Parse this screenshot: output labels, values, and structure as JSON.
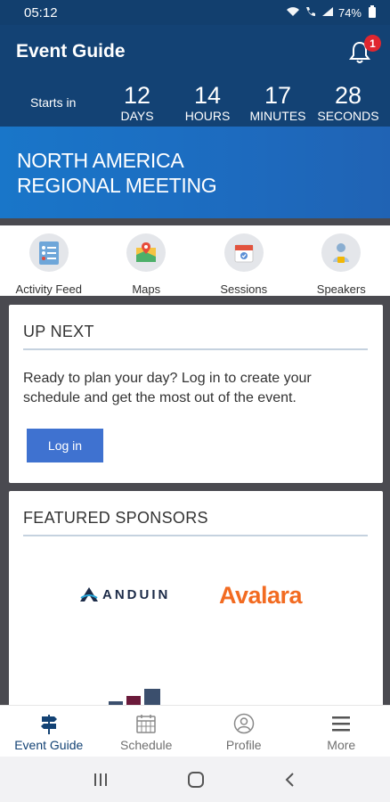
{
  "status_bar": {
    "time": "05:12",
    "battery": "74%"
  },
  "header": {
    "title": "Event Guide",
    "notification_count": "1"
  },
  "countdown": {
    "label": "Starts in",
    "units": [
      {
        "value": "12",
        "label": "DAYS"
      },
      {
        "value": "14",
        "label": "HOURS"
      },
      {
        "value": "17",
        "label": "MINUTES"
      },
      {
        "value": "28",
        "label": "SECONDS"
      }
    ]
  },
  "banner": {
    "line1": "NORTH AMERICA",
    "line2": "REGIONAL MEETING"
  },
  "shortcuts": [
    {
      "label": "Activity Feed",
      "icon": "list-icon"
    },
    {
      "label": "Maps",
      "icon": "map-icon"
    },
    {
      "label": "Sessions",
      "icon": "calendar-icon"
    },
    {
      "label": "Speakers",
      "icon": "speaker-icon"
    }
  ],
  "up_next": {
    "title": "UP NEXT",
    "body": "Ready to plan your day? Log in to create your schedule and get the most out of the event.",
    "button": "Log in"
  },
  "sponsors": {
    "title": "FEATURED SPONSORS",
    "items": [
      "ANDUIN",
      "Avalara"
    ]
  },
  "bottom_nav": [
    {
      "label": "Event Guide",
      "icon": "signpost-icon",
      "active": true
    },
    {
      "label": "Schedule",
      "icon": "calendar-grid-icon",
      "active": false
    },
    {
      "label": "Profile",
      "icon": "user-circle-icon",
      "active": false
    },
    {
      "label": "More",
      "icon": "hamburger-icon",
      "active": false
    }
  ],
  "colors": {
    "header": "#134274",
    "accent": "#3f72d0",
    "badge": "#e0262f",
    "avalara": "#f26b21"
  }
}
